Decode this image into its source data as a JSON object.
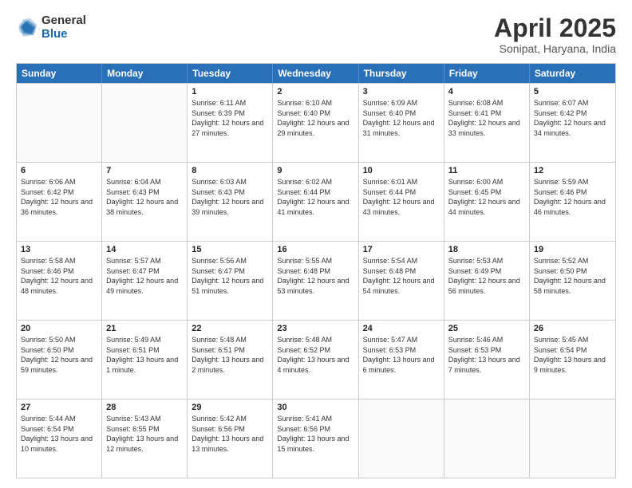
{
  "logo": {
    "general": "General",
    "blue": "Blue"
  },
  "title": "April 2025",
  "subtitle": "Sonipat, Haryana, India",
  "header_days": [
    "Sunday",
    "Monday",
    "Tuesday",
    "Wednesday",
    "Thursday",
    "Friday",
    "Saturday"
  ],
  "weeks": [
    [
      {
        "day": "",
        "sunrise": "",
        "sunset": "",
        "daylight": ""
      },
      {
        "day": "",
        "sunrise": "",
        "sunset": "",
        "daylight": ""
      },
      {
        "day": "1",
        "sunrise": "Sunrise: 6:11 AM",
        "sunset": "Sunset: 6:39 PM",
        "daylight": "Daylight: 12 hours and 27 minutes."
      },
      {
        "day": "2",
        "sunrise": "Sunrise: 6:10 AM",
        "sunset": "Sunset: 6:40 PM",
        "daylight": "Daylight: 12 hours and 29 minutes."
      },
      {
        "day": "3",
        "sunrise": "Sunrise: 6:09 AM",
        "sunset": "Sunset: 6:40 PM",
        "daylight": "Daylight: 12 hours and 31 minutes."
      },
      {
        "day": "4",
        "sunrise": "Sunrise: 6:08 AM",
        "sunset": "Sunset: 6:41 PM",
        "daylight": "Daylight: 12 hours and 33 minutes."
      },
      {
        "day": "5",
        "sunrise": "Sunrise: 6:07 AM",
        "sunset": "Sunset: 6:42 PM",
        "daylight": "Daylight: 12 hours and 34 minutes."
      }
    ],
    [
      {
        "day": "6",
        "sunrise": "Sunrise: 6:06 AM",
        "sunset": "Sunset: 6:42 PM",
        "daylight": "Daylight: 12 hours and 36 minutes."
      },
      {
        "day": "7",
        "sunrise": "Sunrise: 6:04 AM",
        "sunset": "Sunset: 6:43 PM",
        "daylight": "Daylight: 12 hours and 38 minutes."
      },
      {
        "day": "8",
        "sunrise": "Sunrise: 6:03 AM",
        "sunset": "Sunset: 6:43 PM",
        "daylight": "Daylight: 12 hours and 39 minutes."
      },
      {
        "day": "9",
        "sunrise": "Sunrise: 6:02 AM",
        "sunset": "Sunset: 6:44 PM",
        "daylight": "Daylight: 12 hours and 41 minutes."
      },
      {
        "day": "10",
        "sunrise": "Sunrise: 6:01 AM",
        "sunset": "Sunset: 6:44 PM",
        "daylight": "Daylight: 12 hours and 43 minutes."
      },
      {
        "day": "11",
        "sunrise": "Sunrise: 6:00 AM",
        "sunset": "Sunset: 6:45 PM",
        "daylight": "Daylight: 12 hours and 44 minutes."
      },
      {
        "day": "12",
        "sunrise": "Sunrise: 5:59 AM",
        "sunset": "Sunset: 6:46 PM",
        "daylight": "Daylight: 12 hours and 46 minutes."
      }
    ],
    [
      {
        "day": "13",
        "sunrise": "Sunrise: 5:58 AM",
        "sunset": "Sunset: 6:46 PM",
        "daylight": "Daylight: 12 hours and 48 minutes."
      },
      {
        "day": "14",
        "sunrise": "Sunrise: 5:57 AM",
        "sunset": "Sunset: 6:47 PM",
        "daylight": "Daylight: 12 hours and 49 minutes."
      },
      {
        "day": "15",
        "sunrise": "Sunrise: 5:56 AM",
        "sunset": "Sunset: 6:47 PM",
        "daylight": "Daylight: 12 hours and 51 minutes."
      },
      {
        "day": "16",
        "sunrise": "Sunrise: 5:55 AM",
        "sunset": "Sunset: 6:48 PM",
        "daylight": "Daylight: 12 hours and 53 minutes."
      },
      {
        "day": "17",
        "sunrise": "Sunrise: 5:54 AM",
        "sunset": "Sunset: 6:48 PM",
        "daylight": "Daylight: 12 hours and 54 minutes."
      },
      {
        "day": "18",
        "sunrise": "Sunrise: 5:53 AM",
        "sunset": "Sunset: 6:49 PM",
        "daylight": "Daylight: 12 hours and 56 minutes."
      },
      {
        "day": "19",
        "sunrise": "Sunrise: 5:52 AM",
        "sunset": "Sunset: 6:50 PM",
        "daylight": "Daylight: 12 hours and 58 minutes."
      }
    ],
    [
      {
        "day": "20",
        "sunrise": "Sunrise: 5:50 AM",
        "sunset": "Sunset: 6:50 PM",
        "daylight": "Daylight: 12 hours and 59 minutes."
      },
      {
        "day": "21",
        "sunrise": "Sunrise: 5:49 AM",
        "sunset": "Sunset: 6:51 PM",
        "daylight": "Daylight: 13 hours and 1 minute."
      },
      {
        "day": "22",
        "sunrise": "Sunrise: 5:48 AM",
        "sunset": "Sunset: 6:51 PM",
        "daylight": "Daylight: 13 hours and 2 minutes."
      },
      {
        "day": "23",
        "sunrise": "Sunrise: 5:48 AM",
        "sunset": "Sunset: 6:52 PM",
        "daylight": "Daylight: 13 hours and 4 minutes."
      },
      {
        "day": "24",
        "sunrise": "Sunrise: 5:47 AM",
        "sunset": "Sunset: 6:53 PM",
        "daylight": "Daylight: 13 hours and 6 minutes."
      },
      {
        "day": "25",
        "sunrise": "Sunrise: 5:46 AM",
        "sunset": "Sunset: 6:53 PM",
        "daylight": "Daylight: 13 hours and 7 minutes."
      },
      {
        "day": "26",
        "sunrise": "Sunrise: 5:45 AM",
        "sunset": "Sunset: 6:54 PM",
        "daylight": "Daylight: 13 hours and 9 minutes."
      }
    ],
    [
      {
        "day": "27",
        "sunrise": "Sunrise: 5:44 AM",
        "sunset": "Sunset: 6:54 PM",
        "daylight": "Daylight: 13 hours and 10 minutes."
      },
      {
        "day": "28",
        "sunrise": "Sunrise: 5:43 AM",
        "sunset": "Sunset: 6:55 PM",
        "daylight": "Daylight: 13 hours and 12 minutes."
      },
      {
        "day": "29",
        "sunrise": "Sunrise: 5:42 AM",
        "sunset": "Sunset: 6:56 PM",
        "daylight": "Daylight: 13 hours and 13 minutes."
      },
      {
        "day": "30",
        "sunrise": "Sunrise: 5:41 AM",
        "sunset": "Sunset: 6:56 PM",
        "daylight": "Daylight: 13 hours and 15 minutes."
      },
      {
        "day": "",
        "sunrise": "",
        "sunset": "",
        "daylight": ""
      },
      {
        "day": "",
        "sunrise": "",
        "sunset": "",
        "daylight": ""
      },
      {
        "day": "",
        "sunrise": "",
        "sunset": "",
        "daylight": ""
      }
    ]
  ]
}
